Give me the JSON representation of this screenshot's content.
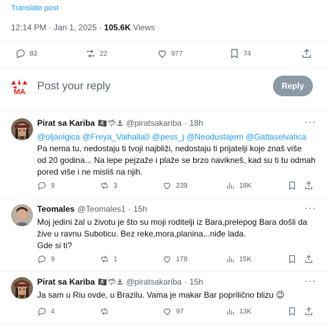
{
  "post": {
    "translate_label": "Translate post",
    "time": "12:14 PM · Jan 1, 2025 · ",
    "views_count": "105.6K",
    "views_label": " Views",
    "stats": {
      "replies": "83",
      "reposts": "22",
      "likes": "977",
      "bookmarks": "74"
    }
  },
  "reply_box": {
    "placeholder": "Post your reply",
    "button": "Reply"
  },
  "replies": [
    {
      "name": "Pirat sa Kariba",
      "badges": "🏴‍☠️🦈⚓",
      "handle": "@piratsakariba",
      "time": "· 18h",
      "mentions": "@oljaolgica @Freya_Valhalla0 @pess_j @Neodustajem @Gattaselvatica",
      "lines": [
        "Pa nema tu, nedostaju ti tvoji najbliži, nedostaju ti prijatelji koje znaš više",
        "od 20 godina... Na lepe pejzaže i plaže se brzo navikneš, kad su ti tu odmah",
        "pored više i ne misliš na njih."
      ],
      "stats": {
        "replies": "9",
        "reposts": "3",
        "likes": "239",
        "views": "18K"
      }
    },
    {
      "name": "Teomales",
      "badges": "",
      "handle": "@Teomales1",
      "time": "· 15h",
      "mentions": "",
      "lines": [
        "Moj jedini žal u životu je što su moji roditelji iz Bara,prelepog Bara došli da",
        "žive u ravnu Suboticu. Bez reke,mora,planina...niđe lada.",
        "Gde si ti?"
      ],
      "stats": {
        "replies": "9",
        "reposts": "1",
        "likes": "178",
        "views": "15K"
      }
    },
    {
      "name": "Pirat sa Kariba",
      "badges": "🏴‍☠️🦈⚓",
      "handle": "@piratsakariba",
      "time": "· 15h",
      "mentions": "",
      "lines": [
        "Ja sam u Riu ovde, u Brazilu. Vama je makar Bar poprilično blizu 😉"
      ],
      "stats": {
        "replies": "4",
        "reposts": "",
        "likes": "97",
        "views": "13K"
      }
    }
  ],
  "colors": {
    "accent": "#1d9bf0",
    "muted": "#536471",
    "reply_button": "#8b98a5"
  },
  "icons": [
    "reply-icon",
    "repost-icon",
    "like-icon",
    "bookmark-icon",
    "share-icon",
    "views-icon",
    "more-icon"
  ]
}
